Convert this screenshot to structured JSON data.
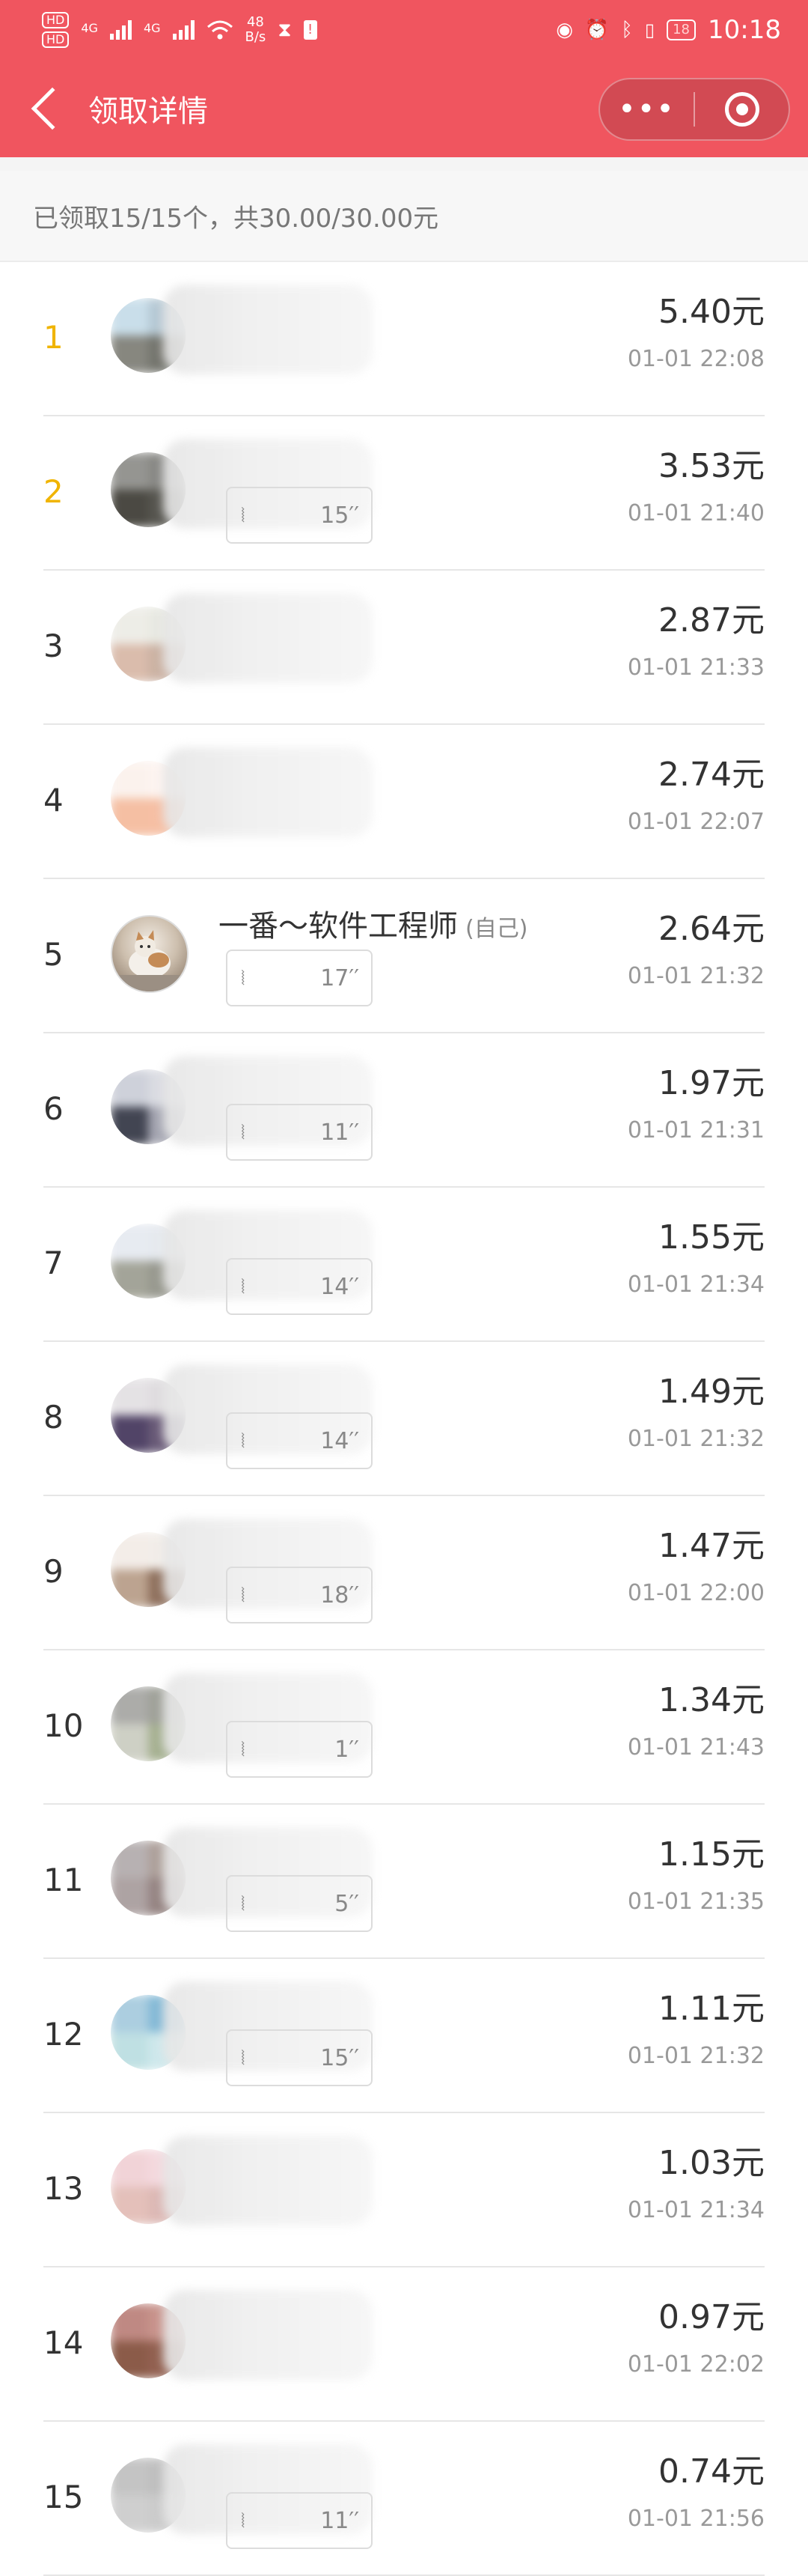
{
  "status_bar": {
    "hd1": "HD",
    "hd2": "HD",
    "net1": "4G",
    "net2": "4G",
    "speed_value": "48",
    "speed_unit": "B/s",
    "battery": "18",
    "time": "10:18"
  },
  "nav": {
    "title": "领取详情",
    "more": "•••"
  },
  "summary": "已领取15/15个，共30.00/30.00元",
  "records": [
    {
      "rank": "1",
      "name": "",
      "amount": "5.40元",
      "time": "01-01 22:08",
      "voice": "",
      "colors": [
        "#c4dbe8",
        "#aec3d0",
        "#7a7a72",
        "#66675f"
      ],
      "gold": true
    },
    {
      "rank": "2",
      "name": "",
      "amount": "3.53元",
      "time": "01-01 21:40",
      "voice": "15′′",
      "colors": [
        "#8a8a86",
        "#7c7c78",
        "#38362f",
        "#45443d"
      ],
      "gold": true
    },
    {
      "rank": "3",
      "name": "",
      "amount": "2.87元",
      "time": "01-01 21:33",
      "voice": "",
      "colors": [
        "#ecebe5",
        "#e6e7df",
        "#d6b5a3",
        "#c6aa9a"
      ]
    },
    {
      "rank": "4",
      "name": "",
      "amount": "2.74元",
      "time": "01-01 22:07",
      "voice": "",
      "colors": [
        "#fbf1ec",
        "#fdf3ef",
        "#f4b99a",
        "#f5b99b"
      ]
    },
    {
      "rank": "5",
      "name": "一番～软件工程师",
      "self": "(自己)",
      "amount": "2.64元",
      "time": "01-01 21:32",
      "voice": "17′′",
      "self_row": true
    },
    {
      "rank": "6",
      "name": "",
      "amount": "1.97元",
      "time": "01-01 21:31",
      "voice": "11′′",
      "colors": [
        "#c9ccd6",
        "#d6d8df",
        "#2e3140",
        "#9b9ca9"
      ]
    },
    {
      "rank": "7",
      "name": "",
      "amount": "1.55元",
      "time": "01-01 21:34",
      "voice": "14′′",
      "colors": [
        "#e5e9f0",
        "#e4e8ee",
        "#9a9b8e",
        "#8d8e83"
      ]
    },
    {
      "rank": "8",
      "name": "",
      "amount": "1.49元",
      "time": "01-01 21:32",
      "voice": "14′′",
      "colors": [
        "#e2dfe2",
        "#dcd9dc",
        "#3f3057",
        "#5a4a6a"
      ]
    },
    {
      "rank": "9",
      "name": "",
      "amount": "1.47元",
      "time": "01-01 22:00",
      "voice": "18′′",
      "colors": [
        "#f2ebe6",
        "#f1ece7",
        "#b59a84",
        "#83614c"
      ]
    },
    {
      "rank": "10",
      "name": "",
      "amount": "1.34元",
      "time": "01-01 21:43",
      "voice": "1′′",
      "colors": [
        "#a3a3a0",
        "#95978e",
        "#c9cbbf",
        "#9ca885"
      ]
    },
    {
      "rank": "11",
      "name": "",
      "amount": "1.15元",
      "time": "01-01 21:35",
      "voice": "5′′",
      "colors": [
        "#b0a9aa",
        "#a59690",
        "#a59999",
        "#8a7775"
      ]
    },
    {
      "rank": "12",
      "name": "",
      "amount": "1.11元",
      "time": "01-01 21:32",
      "voice": "15′′",
      "colors": [
        "#a3c9dd",
        "#77b2d2",
        "#b9dde0",
        "#c9e6ea"
      ]
    },
    {
      "rank": "13",
      "name": "",
      "amount": "1.03元",
      "time": "01-01 21:34",
      "voice": "",
      "colors": [
        "#f0cfd3",
        "#f3d5db",
        "#e1bab3",
        "#d9b1ad"
      ]
    },
    {
      "rank": "14",
      "name": "",
      "amount": "0.97元",
      "time": "01-01 22:02",
      "voice": "",
      "colors": [
        "#b97d76",
        "#c28880",
        "#7f4a36",
        "#87503f"
      ]
    },
    {
      "rank": "15",
      "name": "",
      "amount": "0.74元",
      "time": "01-01 21:56",
      "voice": "11′′",
      "colors": [
        "#bebebe",
        "#b9b9b9",
        "#cacaca",
        "#c6c6c6"
      ]
    }
  ]
}
